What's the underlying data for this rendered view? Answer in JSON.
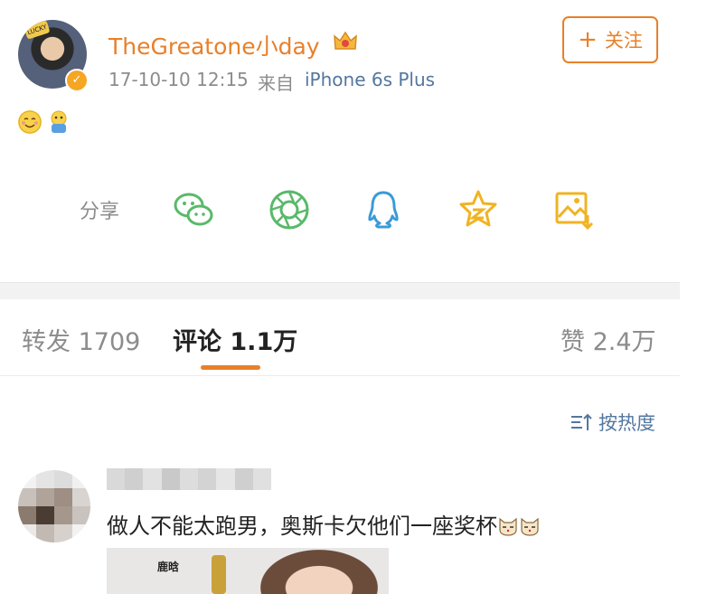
{
  "post": {
    "username": "TheGreatone小day",
    "time": "17-10-10 12:15",
    "source_label": "来自",
    "device": "iPhone 6s Plus",
    "follow_label": "关注",
    "follow_plus": "+"
  },
  "share": {
    "label": "分享",
    "icons": [
      "wechat-icon",
      "moments-icon",
      "qq-icon",
      "qzone-icon",
      "save-image-icon"
    ]
  },
  "tabs": {
    "repost": "转发 1709",
    "comment": "评论 1.1万",
    "like": "赞 2.4万"
  },
  "sort": {
    "label": "按热度"
  },
  "comment": {
    "text": "做人不能太跑男，奥斯卡欠他们一座奖杯",
    "image_caption": "鹿晗"
  },
  "colors": {
    "accent": "#e8802a",
    "link": "#53779f",
    "muted": "#8c8c8c",
    "share_green": "#59b96a",
    "share_blue": "#3a9bd8",
    "share_yellow": "#f0b323"
  }
}
